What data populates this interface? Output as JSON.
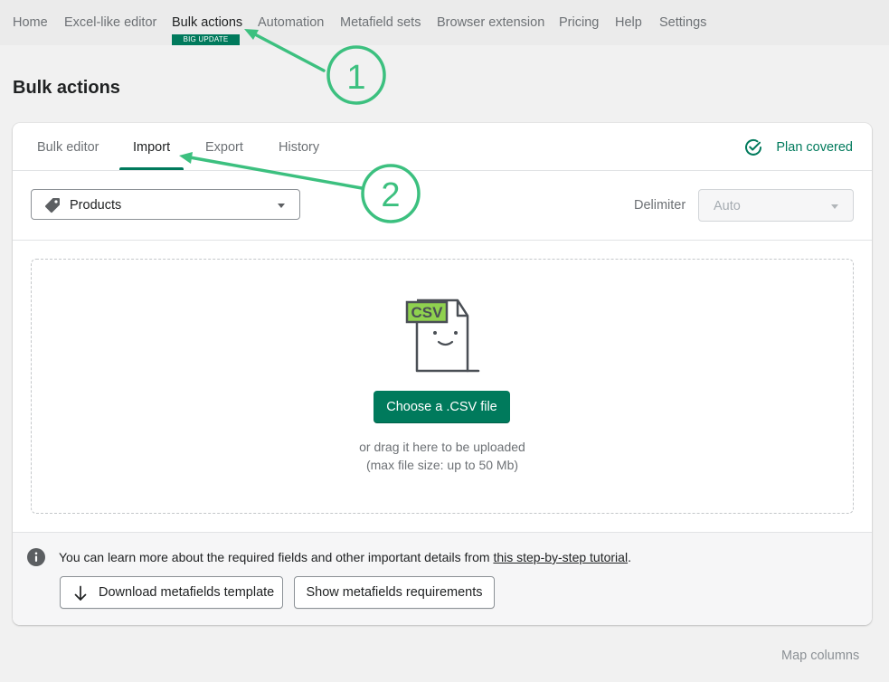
{
  "nav": {
    "items": [
      {
        "label": "Home"
      },
      {
        "label": "Excel-like editor"
      },
      {
        "label": "Bulk actions"
      },
      {
        "label": "Automation"
      },
      {
        "label": "Metafield sets"
      },
      {
        "label": "Browser extension"
      },
      {
        "label": "Pricing"
      },
      {
        "label": "Help"
      },
      {
        "label": "Settings"
      }
    ],
    "badge": "BIG UPDATE"
  },
  "page": {
    "title": "Bulk actions"
  },
  "tabs": [
    {
      "label": "Bulk editor"
    },
    {
      "label": "Import"
    },
    {
      "label": "Export"
    },
    {
      "label": "History"
    }
  ],
  "active_tab": "Import",
  "plan_status": "Plan covered",
  "resource_select": {
    "value": "Products",
    "icon": "tag-icon"
  },
  "delimiter": {
    "label": "Delimiter",
    "value": "Auto"
  },
  "upload": {
    "illustration_text": "CSV",
    "button": "Choose a .CSV file",
    "hint_line1": "or drag it here to be uploaded",
    "hint_line2": "(max file size: up to 50 Mb)"
  },
  "info": {
    "text_before": "You can learn more about the required fields and other important details from ",
    "link": "this step-by-step tutorial",
    "text_after": "."
  },
  "buttons": {
    "download_template": "Download metafields template",
    "show_requirements": "Show metafields requirements"
  },
  "map_columns": "Map columns",
  "annotations": [
    {
      "label": "1"
    },
    {
      "label": "2"
    }
  ],
  "colors": {
    "brand": "#007a5c",
    "annotation": "#3cc07f"
  }
}
